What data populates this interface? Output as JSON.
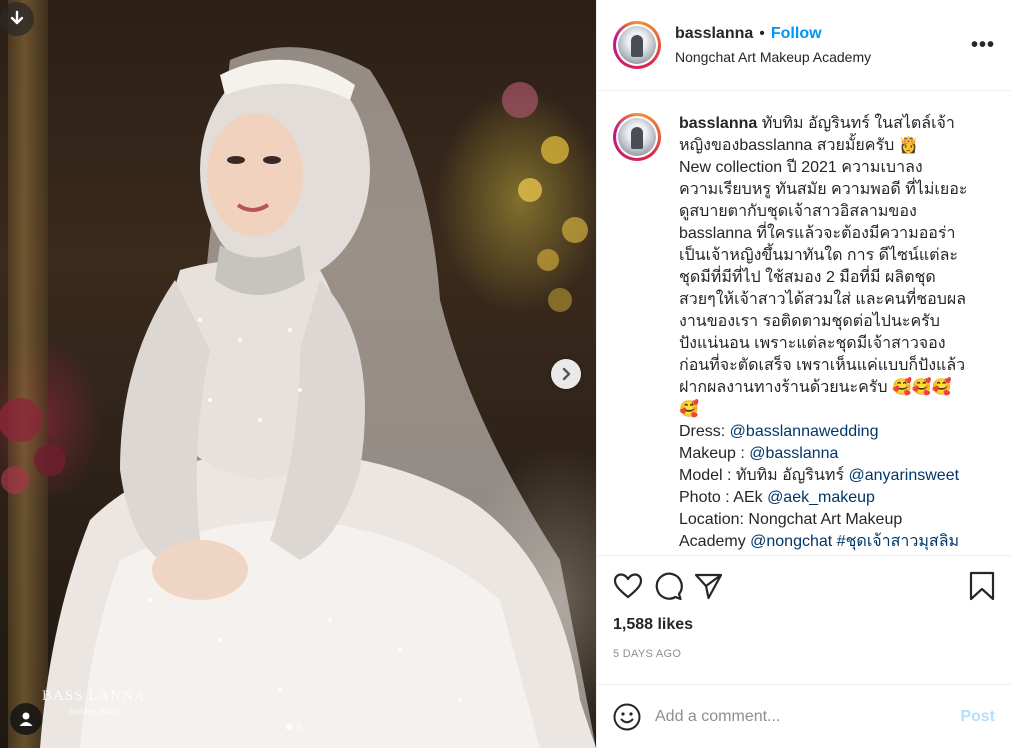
{
  "header": {
    "username": "basslanna",
    "separator": "•",
    "follow_label": "Follow",
    "location": "Nongchat Art Makeup Academy",
    "more_label": "•••"
  },
  "media": {
    "watermark_main": "BASS LANNA",
    "watermark_sub": "Wedding Studio",
    "carousel_count": 2,
    "carousel_active": 0
  },
  "caption": {
    "username": "basslanna",
    "lines": [
      "ทับทิม อัญรินทร์ ในสไตล์เจ้า",
      "หญิงของbasslanna สวยมั้ยครับ 👸",
      "New collection ปี 2021 ความเบาลง",
      "ความเรียบหรู ทันสมัย ความพอดี ที่ไม่เยอะ",
      "ดูสบายตากับชุดเจ้าสาวอิสลามของ",
      "basslanna ที่ใครแล้วจะต้องมีความออร่า",
      "เป็นเจ้าหญิงขึ้นมาทันใด การ ดีไซน์แต่ละ",
      "ชุดมีที่มีที่ไป ใช้สมอง 2 มือที่มี ผลิตชุด",
      "สวยๆให้เจ้าสาวได้สวมใส่ และคนที่ชอบผล",
      "งานของเรา รอติดตามชุดต่อไปนะครับ",
      "ปังแน่นอน เพราะแต่ละชุดมีเจ้าสาวจอง",
      "ก่อนที่จะตัดเสร็จ เพราเห็นแค่แบบก็ปังแล้ว",
      "ฝากผลงานทางร้านด้วยนะครับ 🥰🥰🥰",
      "🥰"
    ],
    "dress_label": "Dress: ",
    "dress_link": "@basslannawedding",
    "makeup_label": "Makeup : ",
    "makeup_link": "@basslanna",
    "model_label": "Model : ทับทิม อัญรินทร์ ",
    "model_link": "@anyarinsweet",
    "photo_label": "Photo : AEk ",
    "photo_link": "@aek_makeup",
    "location_line": "Location: Nongchat Art Makeup",
    "academy_label": "Academy ",
    "academy_link": "@nongchat",
    "hashtag": "#ชุดเจ้าสาวมุสลิม"
  },
  "stats": {
    "likes": "1,588 likes",
    "date": "5 DAYS AGO"
  },
  "comment": {
    "placeholder": "Add a comment...",
    "post_label": "Post"
  },
  "colors": {
    "link": "#00376b",
    "follow": "#0095f6",
    "muted": "#8e8e8e",
    "post_disabled": "#b2dffc"
  }
}
